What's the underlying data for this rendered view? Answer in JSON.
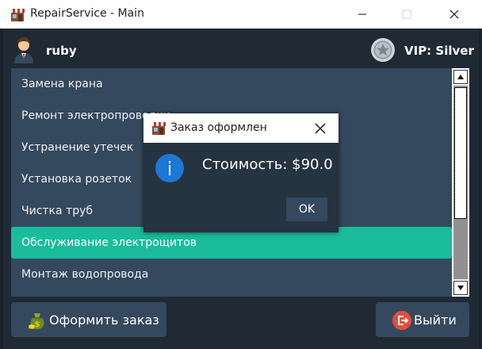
{
  "window": {
    "title": "RepairService - Main",
    "app_icon": "shop-icon",
    "controls": {
      "minimize": "minimize-icon",
      "maximize": "maximize-icon",
      "close": "close-icon"
    }
  },
  "header": {
    "username": "ruby",
    "avatar_icon": "user-avatar-icon",
    "vip_icon": "silver-star-medal-icon",
    "vip_label": "VIP: Silver"
  },
  "services": {
    "items": [
      "Замена крана",
      "Ремонт электропроводки",
      "Устранение утечек",
      "Установка розеток",
      "Чистка труб",
      "Обслуживание электрощитов",
      "Монтаж водопровода"
    ],
    "selected_index": 5
  },
  "buttons": {
    "order_label": "Оформить заказ",
    "order_icon": "money-bag-icon",
    "exit_label": "Выйти",
    "exit_icon": "logout-icon"
  },
  "dialog": {
    "title": "Заказ оформлен",
    "icon": "info-icon",
    "message": "Стоимость: $90.0",
    "ok_label": "OK"
  },
  "colors": {
    "background": "#1f2a35",
    "list_bg": "#34495e",
    "selected": "#1abc9c",
    "info_blue": "#1c78d4",
    "exit_red": "#e74c3c"
  }
}
